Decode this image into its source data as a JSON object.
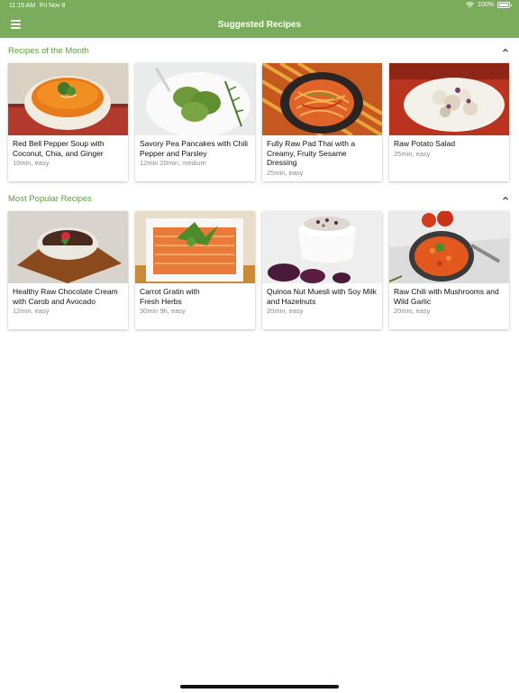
{
  "status_bar": {
    "time": "11:19 AM",
    "date": "Fri Nov 8",
    "battery": "100%",
    "battery_level": 1.0
  },
  "header": {
    "title": "Suggested Recipes",
    "menu_icon": "hamburger-menu-icon",
    "background": "#7aac5c"
  },
  "sections": [
    {
      "title": "Recipes of the Month",
      "collapse_icon": "chevron-up-icon",
      "recipes": [
        {
          "name": "Red Bell Pepper Soup with Coconut, Chia, and Ginger",
          "meta": "10min, easy"
        },
        {
          "name": "Savory Pea Pancakes with Chili Pepper and Parsley",
          "meta": "12min 20min, medium"
        },
        {
          "name": "Fully Raw Pad Thai with a Creamy, Fruity Sesame Dressing",
          "meta": "25min, easy"
        },
        {
          "name": "Raw Potato Salad",
          "meta": "25min, easy"
        }
      ]
    },
    {
      "title": "Most Popular Recipes",
      "collapse_icon": "chevron-up-icon",
      "recipes": [
        {
          "name": "Healthy Raw Chocolate Cream with Carob and Avocado",
          "meta": "12min, easy"
        },
        {
          "name": "Carrot Gratin with\nFresh Herbs",
          "meta": "30min 9h, easy"
        },
        {
          "name": "Quinoa Nut Muesli with Soy Milk and Hazelnuts",
          "meta": "20min, easy"
        },
        {
          "name": "Raw Chili with Mushrooms and Wild Garlic",
          "meta": "20min, easy"
        }
      ]
    }
  ],
  "colors": {
    "accent": "#7aac5c",
    "section_title": "#5f9c3f",
    "meta_text": "#8a8a8a"
  }
}
